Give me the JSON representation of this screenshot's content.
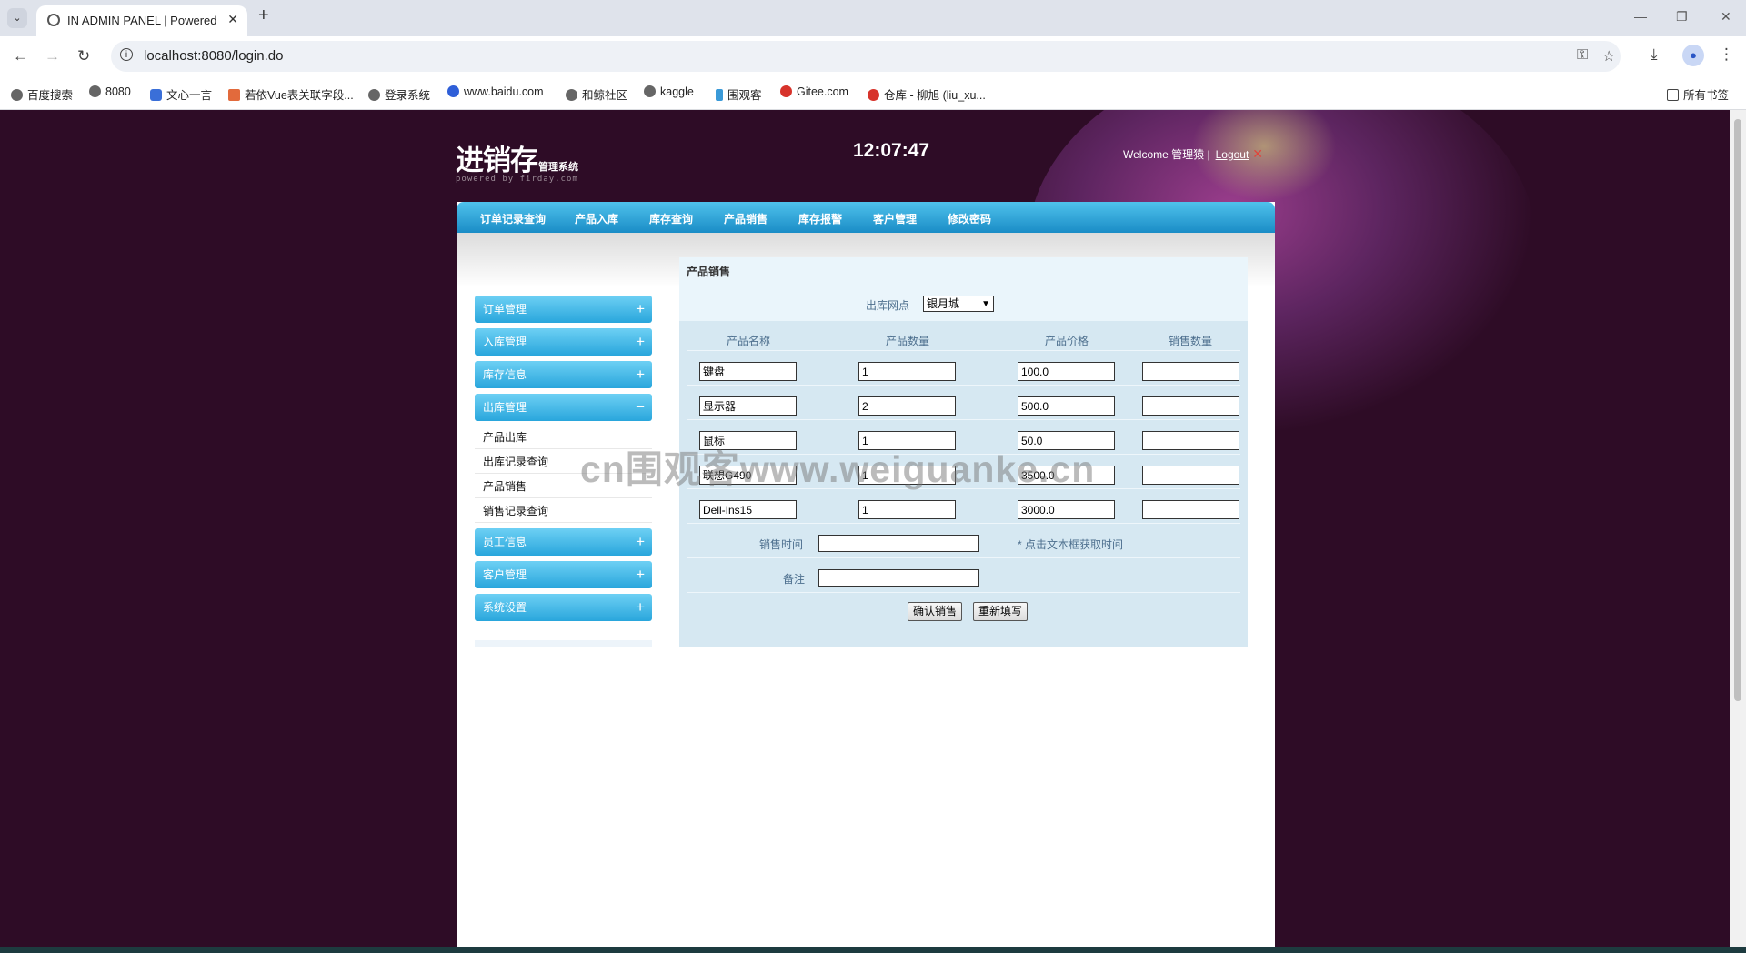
{
  "browser": {
    "tab_title": "IN ADMIN PANEL | Powered",
    "url": "localhost:8080/login.do",
    "bookmarks": [
      "百度搜索",
      "8080",
      "文心一言",
      "若依Vue表关联字段...",
      "登录系统",
      "www.baidu.com",
      "和鲸社区",
      "kaggle",
      "围观客",
      "Gitee.com",
      "仓库 - 柳旭 (liu_xu..."
    ],
    "all_bookmarks": "所有书签"
  },
  "header": {
    "logo_main": "进销存",
    "logo_sub": "管理系统",
    "logo_powered": "powered by firday.com",
    "clock": "12:07:47",
    "welcome": "Welcome 管理猿 |",
    "logout": "Logout"
  },
  "menu": [
    "订单记录查询",
    "产品入库",
    "库存查询",
    "产品销售",
    "库存报警",
    "客户管理",
    "修改密码"
  ],
  "sidebar": {
    "groups": [
      "订单管理",
      "入库管理",
      "库存信息",
      "出库管理",
      "员工信息",
      "客户管理",
      "系统设置"
    ],
    "expanded_items": [
      "产品出库",
      "出库记录查询",
      "产品销售",
      "销售记录查询"
    ]
  },
  "form": {
    "title": "产品销售",
    "warehouse_label": "出库网点",
    "warehouse_value": "银月城",
    "columns": [
      "产品名称",
      "产品数量",
      "产品价格",
      "销售数量"
    ],
    "rows": [
      {
        "name": "键盘",
        "qty": "1",
        "price": "100.0",
        "sale_qty": ""
      },
      {
        "name": "显示器",
        "qty": "2",
        "price": "500.0",
        "sale_qty": ""
      },
      {
        "name": "鼠标",
        "qty": "1",
        "price": "50.0",
        "sale_qty": ""
      },
      {
        "name": "联想G490",
        "qty": "1",
        "price": "3500.0",
        "sale_qty": ""
      },
      {
        "name": "Dell-Ins15",
        "qty": "1",
        "price": "3000.0",
        "sale_qty": ""
      }
    ],
    "sale_time_label": "销售时间",
    "sale_time_hint": "* 点击文本框获取时间",
    "note_label": "备注",
    "confirm_button": "确认销售",
    "reset_button": "重新填写"
  },
  "watermark": "cn围观客www.weiguanke.cn",
  "colors": {
    "page_bg": "#2e0c26",
    "menu_blue": "#1a8cc6",
    "form_bg": "#d6e8f2"
  }
}
